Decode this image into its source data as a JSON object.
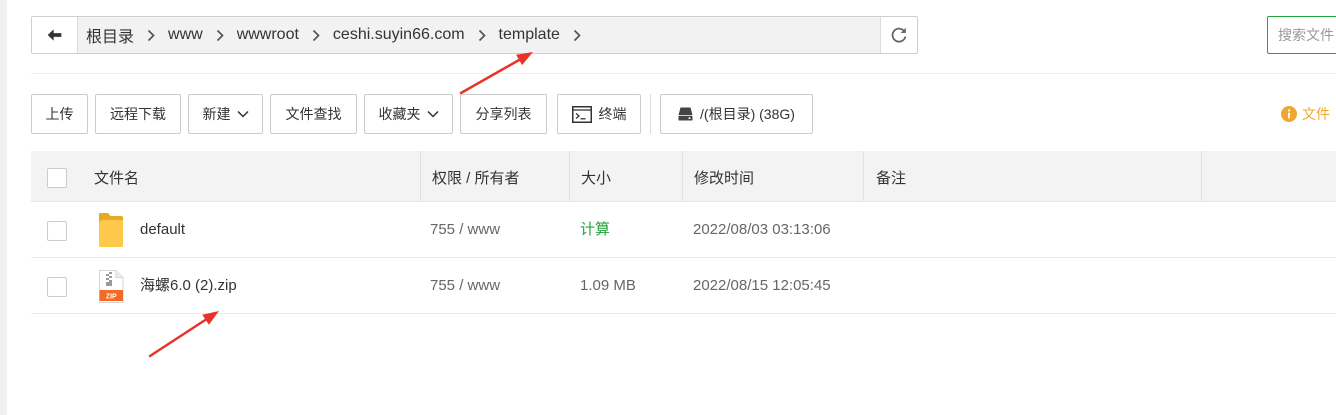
{
  "path_bar": {
    "crumbs": [
      "根目录",
      "www",
      "wwwroot",
      "ceshi.suyin66.com",
      "template"
    ]
  },
  "search": {
    "placeholder": "搜索文件"
  },
  "toolbar": {
    "upload": "上传",
    "remote_download": "远程下载",
    "new": "新建",
    "find": "文件查找",
    "favorites": "收藏夹",
    "share_list": "分享列表",
    "terminal": "终端",
    "disk": "/(根目录) (38G)"
  },
  "info_tip": {
    "text": "文件"
  },
  "table": {
    "headers": {
      "name": "文件名",
      "permission": "权限 / 所有者",
      "size": "大小",
      "modified": "修改时间",
      "note": "备注"
    },
    "rows": [
      {
        "icon": "folder-icon",
        "name": "default",
        "permission": "755 / www",
        "size": "计算",
        "modified": "2022/08/03 03:13:06"
      },
      {
        "icon": "zip-file-icon",
        "icon_label": "ZIP",
        "name": "海螺6.0 (2).zip",
        "permission": "755 / www",
        "size": "1.09 MB",
        "modified": "2022/08/15 12:05:45"
      }
    ]
  },
  "icons": {
    "back": "arrow-left-icon",
    "separator": "chevron-right-icon",
    "refresh": "refresh-icon",
    "dropdown": "chevron-down-icon",
    "terminal": "terminal-icon",
    "disk": "disk-icon",
    "info": "info-icon"
  },
  "colors": {
    "accent_green": "#20a53a",
    "info_orange": "#f0a732",
    "annotation_red": "#e8322b"
  }
}
